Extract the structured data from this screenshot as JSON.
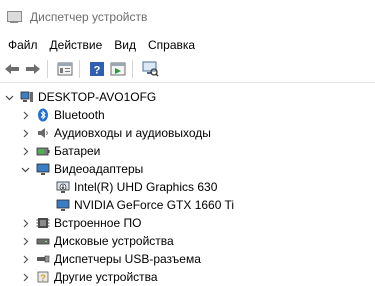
{
  "window": {
    "title": "Диспетчер устройств"
  },
  "menu": {
    "items": [
      "Файл",
      "Действие",
      "Вид",
      "Справка"
    ]
  },
  "toolbar": {
    "buttons": [
      "back-arrow-icon",
      "forward-arrow-icon",
      "properties-icon",
      "help-icon",
      "update-driver-icon",
      "scan-hardware-icon"
    ]
  },
  "tree": {
    "root": {
      "label": "DESKTOP-AVO1OFG",
      "icon": "computer-icon",
      "expanded": true
    },
    "categories": [
      {
        "label": "Bluetooth",
        "icon": "bluetooth-icon",
        "expanded": false
      },
      {
        "label": "Аудиовходы и аудиовыходы",
        "icon": "speaker-icon",
        "expanded": false
      },
      {
        "label": "Батареи",
        "icon": "battery-icon",
        "expanded": false
      },
      {
        "label": "Видеоадаптеры",
        "icon": "display-adapter-icon",
        "expanded": true,
        "children": [
          {
            "label": "Intel(R) UHD Graphics 630",
            "icon": "display-adapter-warning-icon"
          },
          {
            "label": "NVIDIA GeForce GTX 1660 Ti",
            "icon": "display-adapter-icon"
          }
        ]
      },
      {
        "label": "Встроенное ПО",
        "icon": "firmware-icon",
        "expanded": false
      },
      {
        "label": "Дисковые устройства",
        "icon": "disk-icon",
        "expanded": false
      },
      {
        "label": "Диспетчеры USB-разъема",
        "icon": "usb-icon",
        "expanded": false
      },
      {
        "label": "Другие устройства",
        "icon": "other-device-icon",
        "expanded": false
      }
    ]
  }
}
